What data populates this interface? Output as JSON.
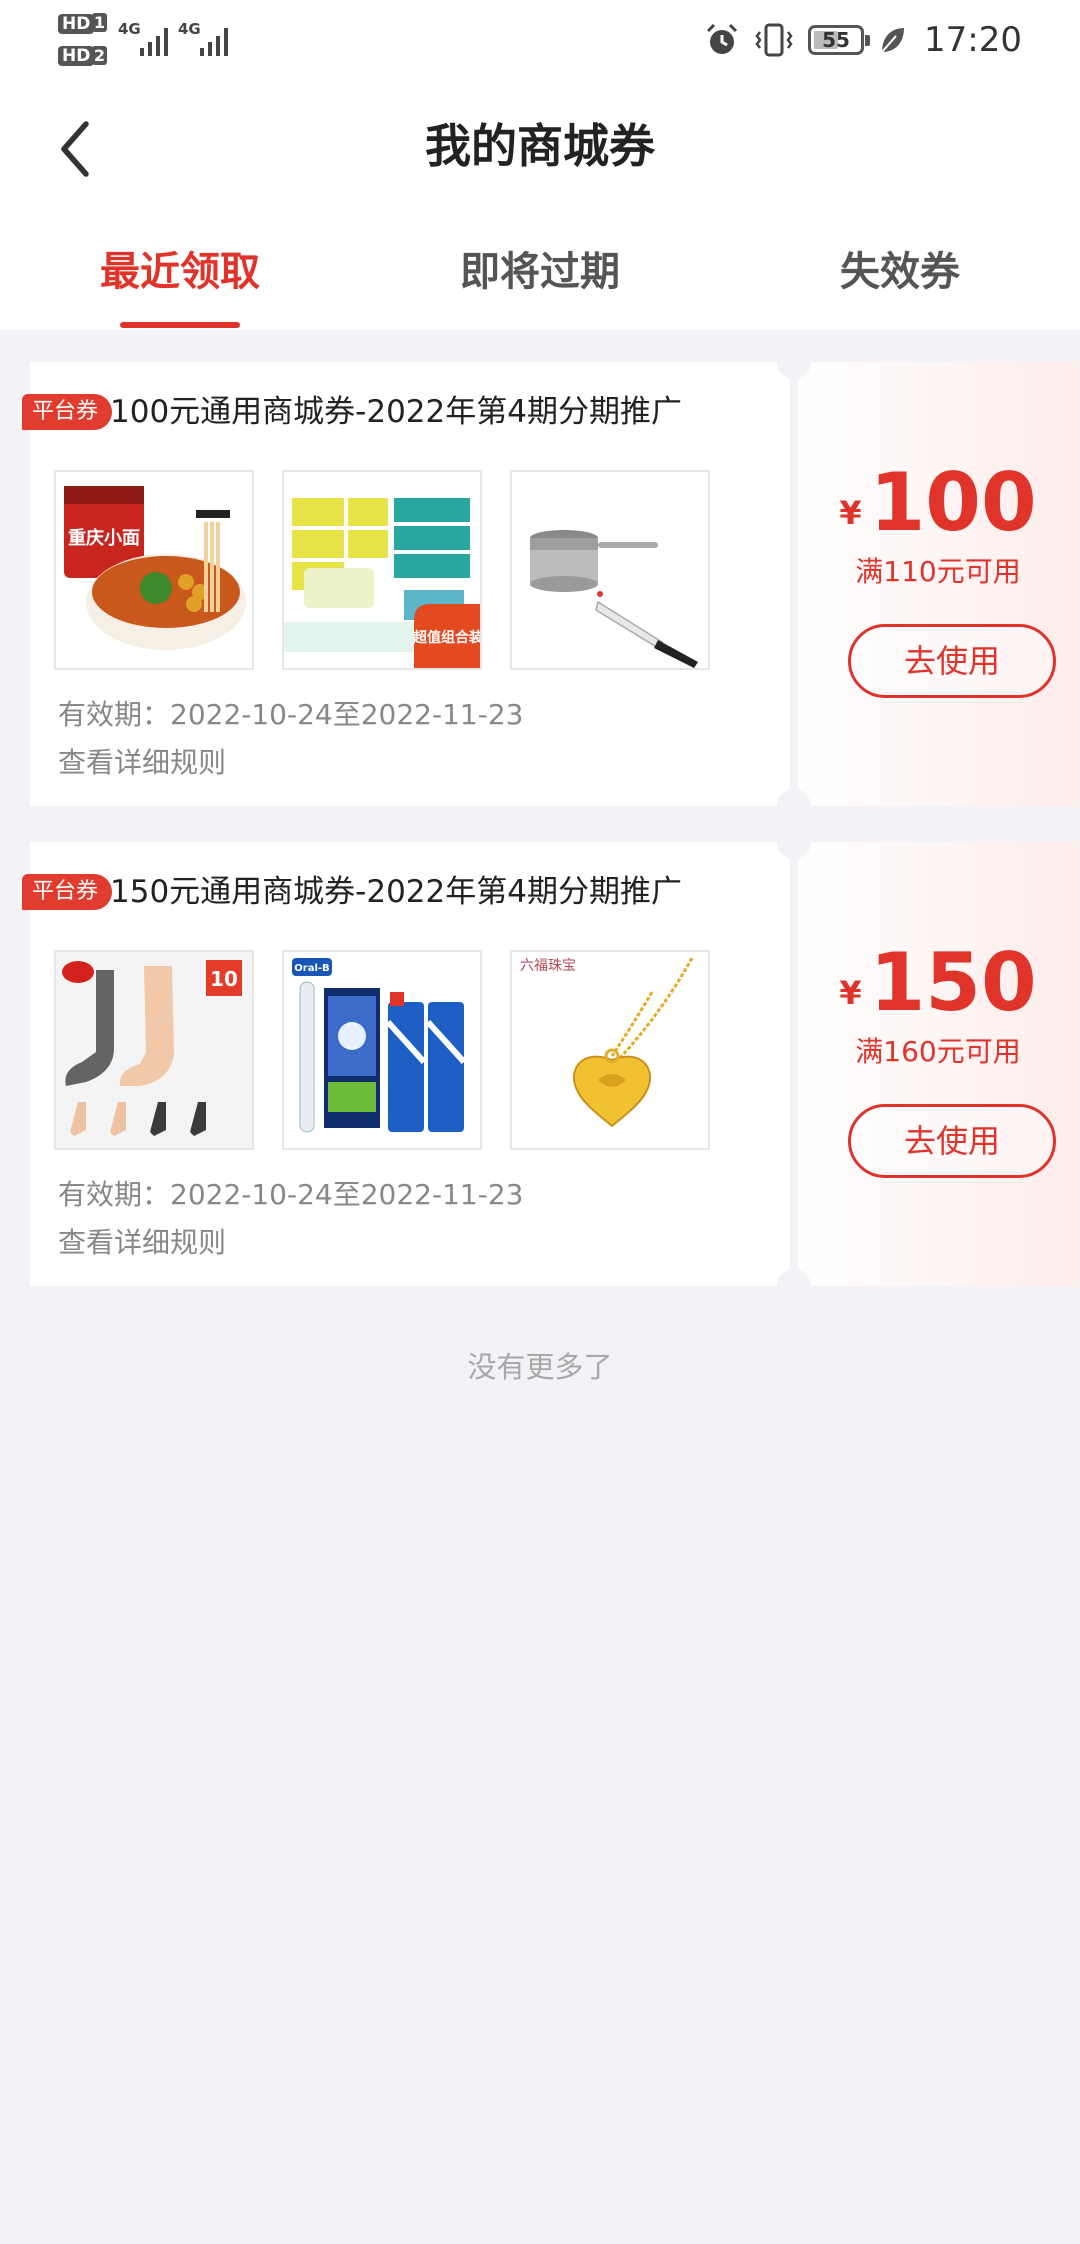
{
  "status_bar": {
    "hd1": "HD",
    "sim1": "1",
    "hd2": "HD",
    "sim2": "2",
    "net1": "4G",
    "net2": "4G",
    "battery": "55",
    "time": "17:20",
    "icons": [
      "alarm-icon",
      "vibrate-icon",
      "battery-icon",
      "leaf-icon"
    ]
  },
  "header": {
    "title": "我的商城券",
    "back_icon": "chevron-left-icon"
  },
  "tabs": [
    {
      "label": "最近领取",
      "active": true
    },
    {
      "label": "即将过期",
      "active": false
    },
    {
      "label": "失效券",
      "active": false
    }
  ],
  "coupons": [
    {
      "tag": "平台券",
      "title": "100元通用商城券-2022年第4期分期推广",
      "products": [
        "noodle-bowl-image",
        "tissue-pack-image",
        "pot-and-knife-image"
      ],
      "product_texts": {
        "noodle_label": "重庆小面",
        "tissue_badge": "超值组合装"
      },
      "validity": "有效期：2022-10-24至2022-11-23",
      "rules": "查看详细规则",
      "currency": "¥",
      "amount": "100",
      "condition": "满110元可用",
      "button": "去使用"
    },
    {
      "tag": "平台券",
      "title": "150元通用商城券-2022年第4期分期推广",
      "products": [
        "socks-image",
        "toothbrush-toothpaste-image",
        "gold-pendant-image"
      ],
      "product_texts": {
        "socks_badge": "10",
        "toothbrush_brand": "Oral-B",
        "pendant_brand": "六福珠宝"
      },
      "validity": "有效期：2022-10-24至2022-11-23",
      "rules": "查看详细规则",
      "currency": "¥",
      "amount": "150",
      "condition": "满160元可用",
      "button": "去使用"
    }
  ],
  "footer_note": "没有更多了",
  "colors": {
    "accent": "#e0342a",
    "page_bg": "#f3f2f7",
    "muted_text": "#888888"
  }
}
